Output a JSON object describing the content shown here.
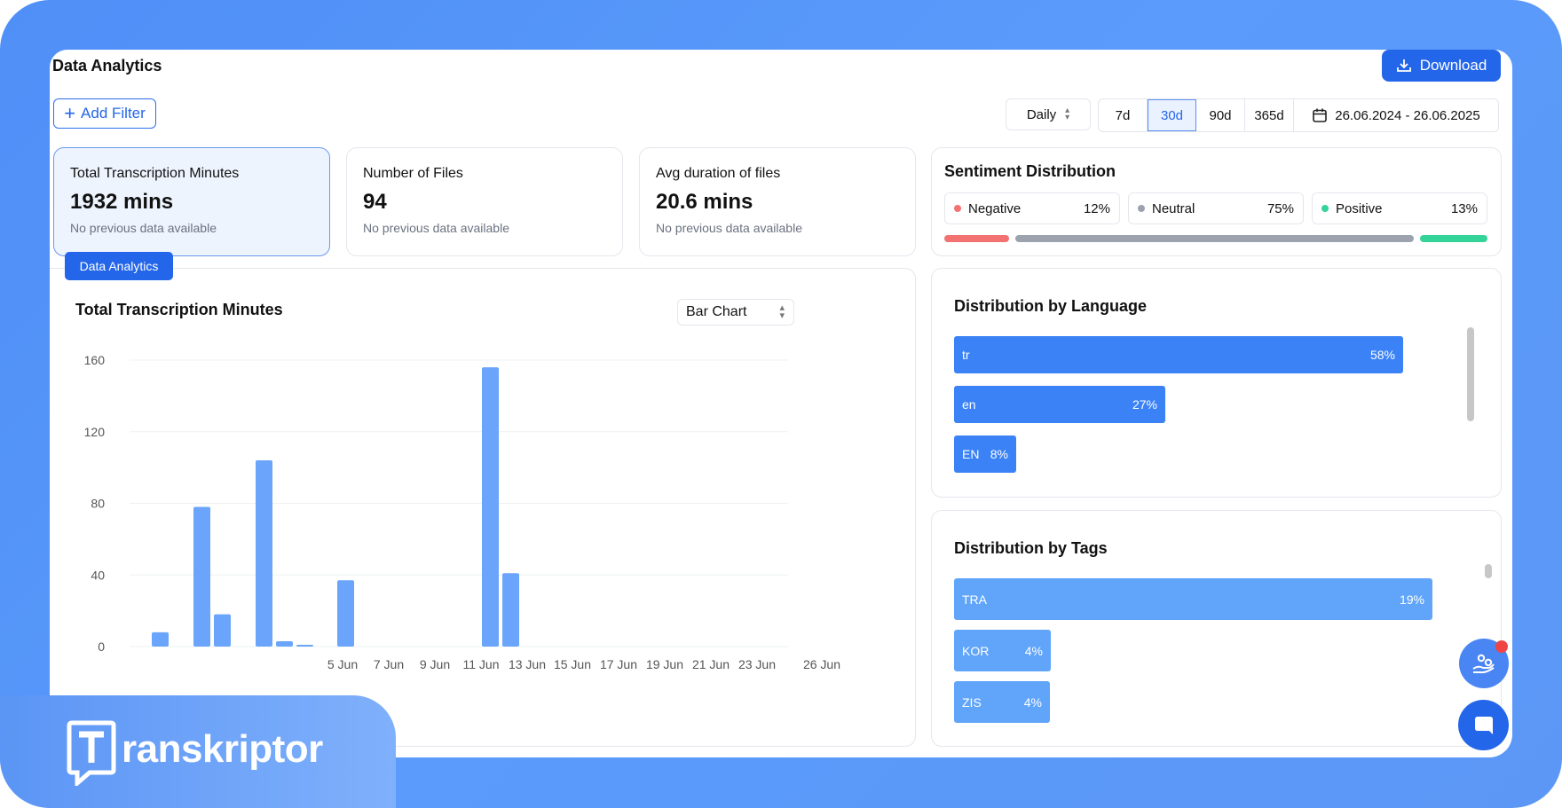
{
  "header": {
    "title": "Data Analytics",
    "download_label": "Download"
  },
  "filters": {
    "add_filter_label": "Add Filter",
    "interval": "Daily",
    "ranges": [
      "7d",
      "30d",
      "90d",
      "365d"
    ],
    "active_range": "30d",
    "date_range": "26.06.2024 - 26.06.2025"
  },
  "stats": [
    {
      "label": "Total Transcription Minutes",
      "value": "1932 mins",
      "sub": "No previous data available"
    },
    {
      "label": "Number of Files",
      "value": "94",
      "sub": "No previous data available"
    },
    {
      "label": "Avg duration of files",
      "value": "20.6 mins",
      "sub": "No previous data available"
    }
  ],
  "tooltip": "Data Analytics",
  "sentiment": {
    "title": "Sentiment Distribution",
    "items": [
      {
        "label": "Negative",
        "pct": "12%",
        "value": 12,
        "color": "#f27171"
      },
      {
        "label": "Neutral",
        "pct": "75%",
        "value": 75,
        "color": "#9ca3af"
      },
      {
        "label": "Positive",
        "pct": "13%",
        "value": 13,
        "color": "#34d399"
      }
    ]
  },
  "chart_panel": {
    "title": "Total Transcription Minutes",
    "chart_type_select": "Bar Chart"
  },
  "chart_data": {
    "type": "bar",
    "title": "Total Transcription Minutes",
    "ylim": [
      0,
      160
    ],
    "yticks": [
      0,
      40,
      80,
      120,
      160
    ],
    "x_labels": [
      "5 Jun",
      "7 Jun",
      "9 Jun",
      "11 Jun",
      "13 Jun",
      "15 Jun",
      "17 Jun",
      "19 Jun",
      "21 Jun",
      "23 Jun",
      "26 Jun"
    ],
    "bars": [
      {
        "value": 8
      },
      {
        "value": 78
      },
      {
        "value": 18
      },
      {
        "value": 104
      },
      {
        "value": 3
      },
      {
        "value": 1
      },
      {
        "value": 37
      },
      {
        "value": 156
      },
      {
        "value": 41
      }
    ],
    "color": "#6aa4fb",
    "grid": true
  },
  "language": {
    "title": "Distribution by Language",
    "items": [
      {
        "label": "tr",
        "pct": "58%",
        "value": 58
      },
      {
        "label": "en",
        "pct": "27%",
        "value": 27
      },
      {
        "label": "EN",
        "pct": "8%",
        "value": 8
      }
    ],
    "color": "#3b82f6"
  },
  "tags": {
    "title": "Distribution by Tags",
    "items": [
      {
        "label": "TRA",
        "pct": "19%",
        "value": 19
      },
      {
        "label": "KOR",
        "pct": "4%",
        "value": 4
      },
      {
        "label": "ZIS",
        "pct": "4%",
        "value": 4
      }
    ],
    "color": "#60a5fa"
  },
  "brand": {
    "name": "ranskriptor",
    "mark": "T"
  }
}
